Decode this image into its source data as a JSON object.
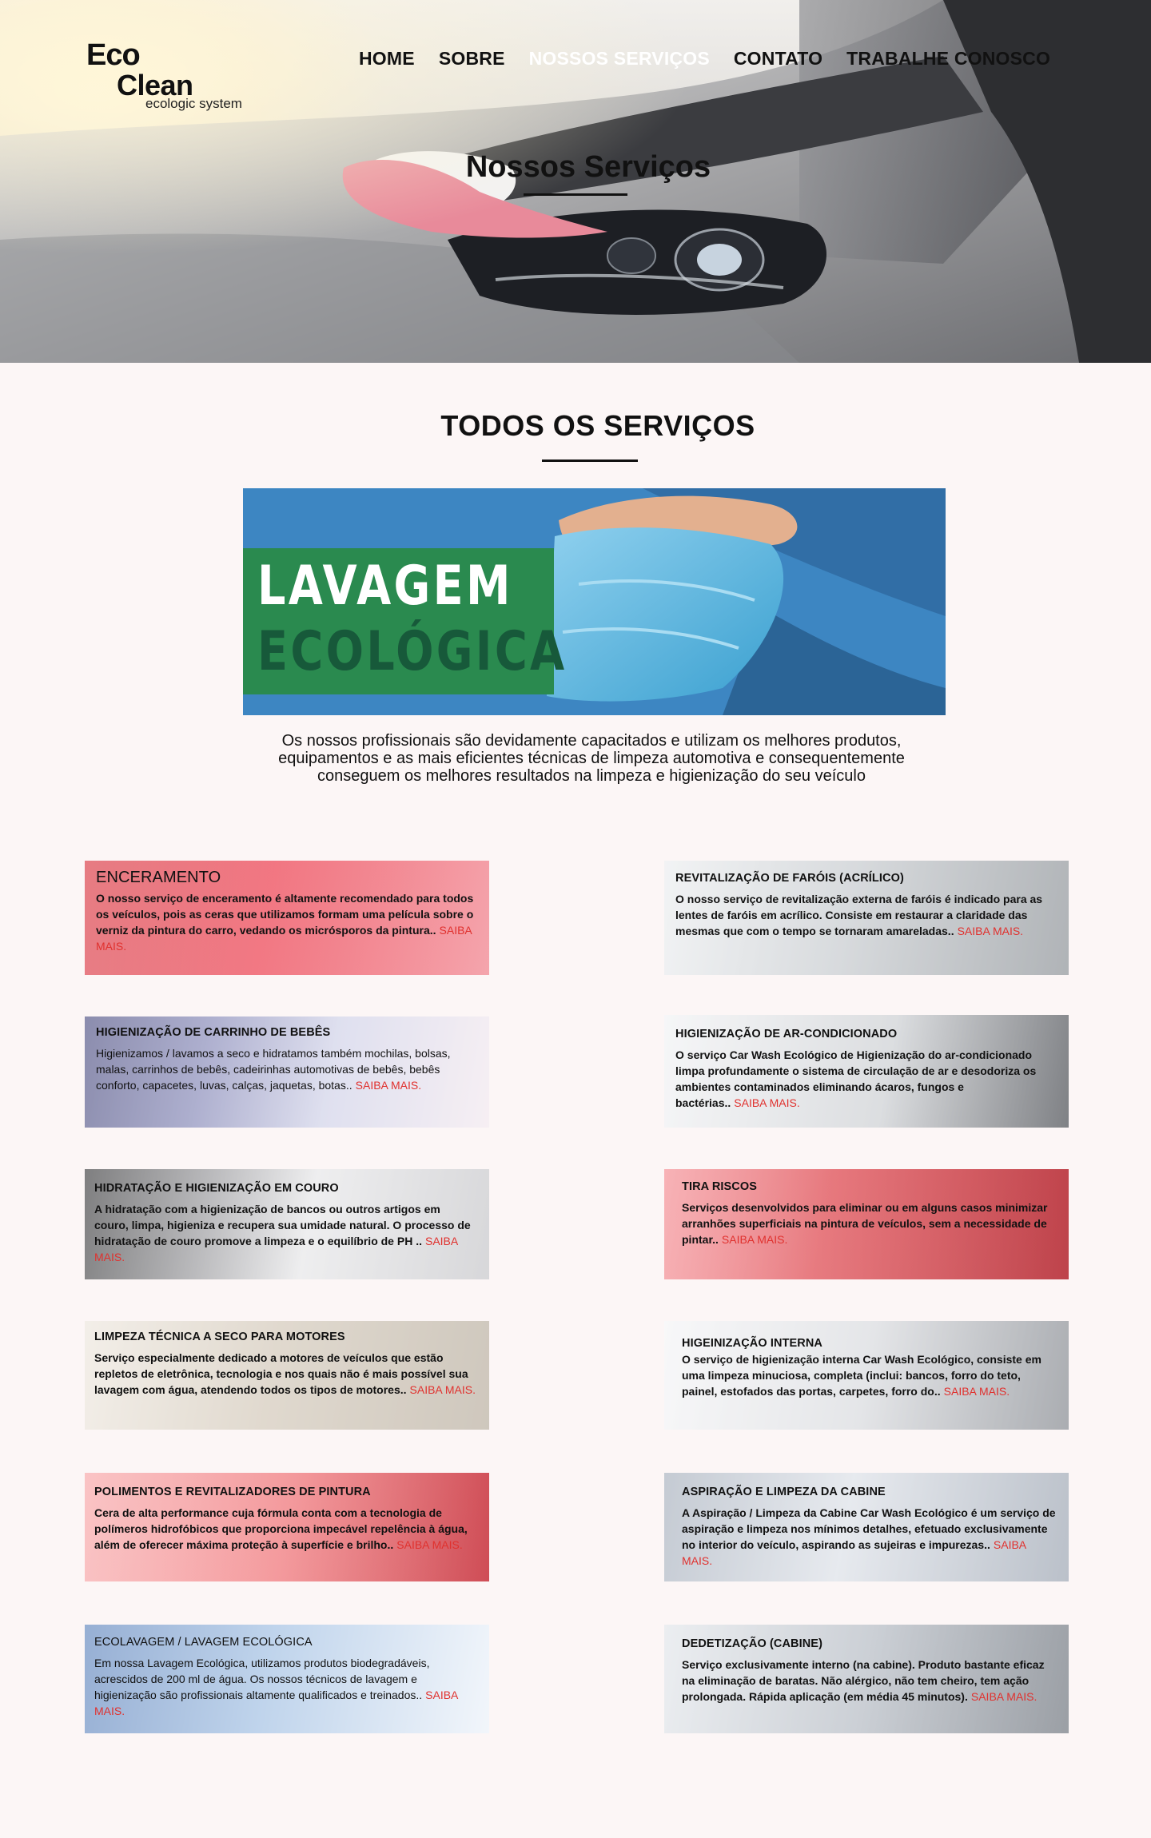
{
  "logo": {
    "line1": "Eco",
    "line2": "Clean",
    "tagline": "ecologic system"
  },
  "nav": [
    {
      "label": "HOME"
    },
    {
      "label": "SOBRE"
    },
    {
      "label": "NOSSOS SERVIÇOS"
    },
    {
      "label": "CONTATO"
    },
    {
      "label": "TRABALHE CONOSCO"
    }
  ],
  "hero": {
    "title": "Nossos Serviços"
  },
  "section": {
    "title": "TODOS OS SERVIÇOS"
  },
  "banner": {
    "line1": "LAVAGEM",
    "line2": "ECOLÓGICA",
    "description": "Os nossos profissionais são devidamente capacitados e utilizam os melhores produtos, equipamentos e as mais eficientes técnicas de limpeza automotiva e consequentemente conseguem os melhores resultados na limpeza e higienização do seu veículo"
  },
  "services": [
    {
      "title": "ENCERAMENTO",
      "text": "O nosso serviço de enceramento é altamente recomendado para todos os veículos, pois as ceras que utilizamos formam uma película sobre o verniz da pintura do carro, vedando os micrósporos da pintura..",
      "more": "SAIBA MAIS."
    },
    {
      "title": "REVITALIZAÇÃO DE FARÓIS (ACRÍLICO)",
      "text": "O nosso serviço de revitalização externa de faróis é indicado para as lentes de faróis em acrílico. Consiste em restaurar a claridade das mesmas que com o tempo se tornaram amareladas..",
      "more": "SAIBA MAIS."
    },
    {
      "title": "HIGIENIZAÇÃO DE CARRINHO DE BEBÊS",
      "text": "Higienizamos / lavamos a seco e hidratamos também mochilas, bolsas, malas, carrinhos de bebês, cadeirinhas automotivas de bebês, bebês conforto, capacetes, luvas, calças, jaquetas, botas..",
      "more": "SAIBA MAIS."
    },
    {
      "title": "HIGIENIZAÇÃO DE AR-CONDICIONADO",
      "text": "O serviço Car Wash Ecológico de Higienização do ar-condicionado limpa profundamente o sistema de circulação de ar e desodoriza os ambientes contaminados eliminando ácaros, fungos e bactérias..",
      "more": "SAIBA MAIS."
    },
    {
      "title": "HIDRATAÇÃO E HIGIENIZAÇÃO EM COURO",
      "text": "A hidratação com a higienização de bancos ou outros artigos em couro, limpa, higieniza e recupera sua umidade natural. O processo de hidratação de couro promove a limpeza e o equilíbrio de PH ..",
      "more": "SAIBA MAIS."
    },
    {
      "title": "TIRA RISCOS",
      "text": "Serviços desenvolvidos para eliminar ou em alguns casos minimizar arranhões superficiais na pintura de veículos, sem a necessidade de pintar..",
      "more": "SAIBA MAIS."
    },
    {
      "title": "LIMPEZA TÉCNICA A SECO PARA MOTORES",
      "text": "Serviço especialmente dedicado a motores de veículos que estão repletos de eletrônica, tecnologia e nos quais não é mais possível sua lavagem com água, atendendo todos os tipos de motores..",
      "more": "SAIBA MAIS."
    },
    {
      "title": "HIGEINIZAÇÃO INTERNA",
      "text": "O serviço de higienização interna Car Wash Ecológico, consiste em uma limpeza minuciosa, completa (inclui: bancos, forro do teto, painel, estofados das portas, carpetes, forro do..",
      "more": "SAIBA MAIS."
    },
    {
      "title": "POLIMENTOS E REVITALIZADORES DE PINTURA",
      "text": "Cera de alta performance cuja fórmula conta com a tecnologia de polímeros hidrofóbicos que proporciona impecável repelência à água, além de oferecer máxima proteção à superfície e brilho..",
      "more": "SAIBA MAIS."
    },
    {
      "title": "ASPIRAÇÃO E LIMPEZA DA CABINE",
      "text": "A Aspiração / Limpeza da Cabine Car Wash Ecológico é um serviço de aspiração e limpeza nos mínimos detalhes, efetuado exclusivamente no interior do veículo, aspirando as sujeiras e impurezas..",
      "more": "SAIBA MAIS."
    },
    {
      "title": "ECOLAVAGEM / LAVAGEM ECOLÓGICA",
      "text": "Em nossa Lavagem Ecológica, utilizamos produtos biodegradáveis, acrescidos de 200 ml de água. Os nossos técnicos de lavagem e higienização são profissionais altamente qualificados e treinados..",
      "more": "SAIBA MAIS."
    },
    {
      "title": "DEDETIZAÇÃO (CABINE)",
      "text": "Serviço exclusivamente interno (na cabine). Produto bastante eficaz na eliminação de baratas. Não alérgico, não tem cheiro, tem ação prolongada. Rápida aplicação (em média 45 minutos).",
      "more": "SAIBA MAIS."
    }
  ]
}
